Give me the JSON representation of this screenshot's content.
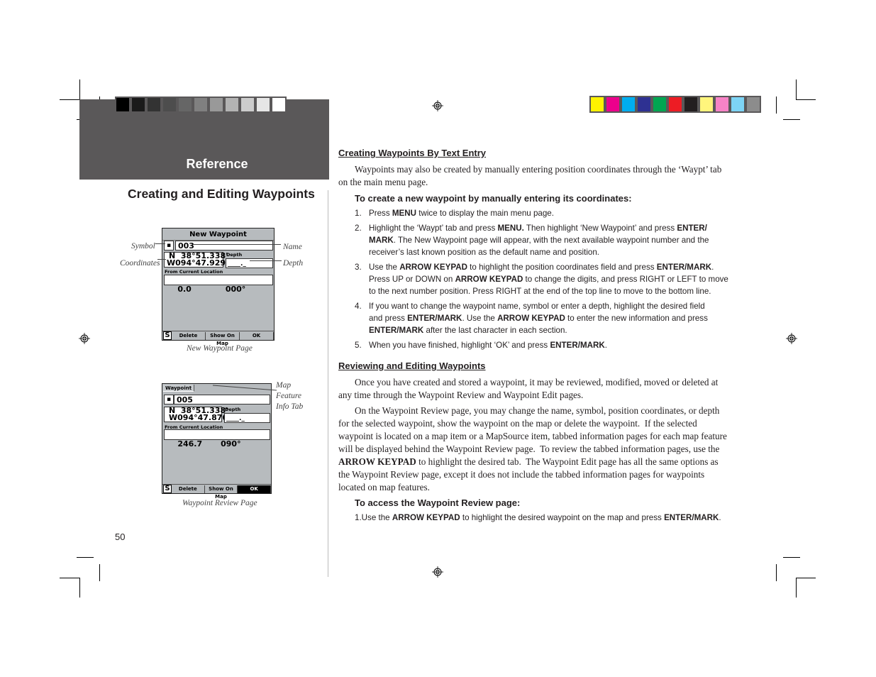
{
  "header": {
    "section_tab": "Reference",
    "page_title": "Creating and Editing Waypoints",
    "page_number": "50"
  },
  "print_marks": {
    "gray_swatches": [
      "#000000",
      "#1a1a1a",
      "#333333",
      "#4d4d4d",
      "#666666",
      "#808080",
      "#999999",
      "#b3b3b3",
      "#cccccc",
      "#e6e6e6",
      "#ffffff"
    ],
    "color_swatches": [
      "#fff200",
      "#ec008c",
      "#00aeef",
      "#2e3192",
      "#00a651",
      "#ed1c24",
      "#231f20",
      "#fff57c",
      "#f783c6",
      "#7dd4f5",
      "#8c8c8c"
    ]
  },
  "figures": {
    "new_waypoint": {
      "title": "New Waypoint",
      "symbol": "▪",
      "name": "003",
      "coord_line1": "N  38°51.338'",
      "coord_line2": "W094°47.929'",
      "depth_label": "Depth",
      "depth_value": "____._",
      "from_label": "From Current Location",
      "distance": "0.0",
      "bearing": "000°",
      "footer_s": "S",
      "footer_buttons": [
        "Delete",
        "Show On Map",
        "OK"
      ],
      "callouts": {
        "symbol": "Symbol",
        "coordinates": "Coordinates",
        "name": "Name",
        "depth": "Depth"
      },
      "caption": "New Waypoint Page"
    },
    "waypoint_review": {
      "tab_label": "Waypoint",
      "symbol": "▪",
      "name": "005",
      "coord_line1": "N  38°51.338'",
      "coord_line2": "W094°47.876'",
      "depth_label": "Depth",
      "depth_value": "____._",
      "from_label": "From Current Location",
      "distance": "246.7",
      "bearing": "090°",
      "footer_s": "S",
      "footer_buttons": [
        "Delete",
        "Show On Map",
        "OK"
      ],
      "active_button": "OK",
      "callouts": {
        "map_feature_line1": "Map",
        "map_feature_line2": "Feature",
        "map_feature_line3": "Info Tab"
      },
      "caption": "Waypoint Review Page"
    }
  },
  "content": {
    "section1": {
      "heading": "Creating Waypoints By Text Entry",
      "intro": "Waypoints may also be created by manually entering position coordinates through the ‘Waypt’ tab on the main menu page.",
      "subheading": "To create a new waypoint by manually entering its coordinates:",
      "steps": [
        {
          "num": "1.",
          "html": "Press <b>MENU</b> twice to display the main menu page."
        },
        {
          "num": "2.",
          "html": "Highlight the ‘Waypt’ tab and press <b>MENU.</b> Then highlight ‘New Waypoint’ and press <b>ENTER/ MARK</b>. The New Waypoint page will appear, with the next available waypoint number and the receiver’s last known position as the default name and position."
        },
        {
          "num": "3.",
          "html": "Use the <b>ARROW KEYPAD</b> to highlight the position coordinates field and press <b>ENTER/MARK</b>. Press UP or DOWN on <b>ARROW KEYPAD</b> to change the digits, and press RIGHT or LEFT to move to the next number position. Press RIGHT at the end of the top line to move to the bottom line."
        },
        {
          "num": "4.",
          "html": "If you want to change the waypoint name, symbol or enter a depth, highlight the desired field and press <b>ENTER/MARK</b>. Use the <b>ARROW KEYPAD</b> to enter the new information and press <b>ENTER/MARK</b> after the last character in each section."
        },
        {
          "num": "5.",
          "html": "When you have finished, highlight ‘OK’ and press <b>ENTER/MARK</b>."
        }
      ]
    },
    "section2": {
      "heading": "Reviewing and Editing Waypoints",
      "para1": "Once you have created and stored a waypoint, it may be reviewed, modified, moved or deleted at any time through the Waypoint Review and Waypoint Edit pages.",
      "para2_html": "On the Waypoint Review page, you may change the name, symbol, position coordinates, or depth for the selected waypoint, show the waypoint on the map or delete the waypoint.&nbsp; If the selected waypoint is located on a map item or a MapSource item, tabbed information pages for each map feature will be displayed behind the Waypoint Review page.&nbsp; To review the tabbed information pages, use the <b>ARROW KEYPAD</b> to highlight the desired tab.&nbsp; The Waypoint Edit page has all the same options as the Waypoint Review page, except it does not include the tabbed information pages for waypoints located on map features.",
      "subheading": "To access the Waypoint Review page:",
      "step_html": "1.Use the <b>ARROW KEYPAD</b> to highlight the desired waypoint on the map and press <b>ENTER/MARK</b>."
    }
  }
}
